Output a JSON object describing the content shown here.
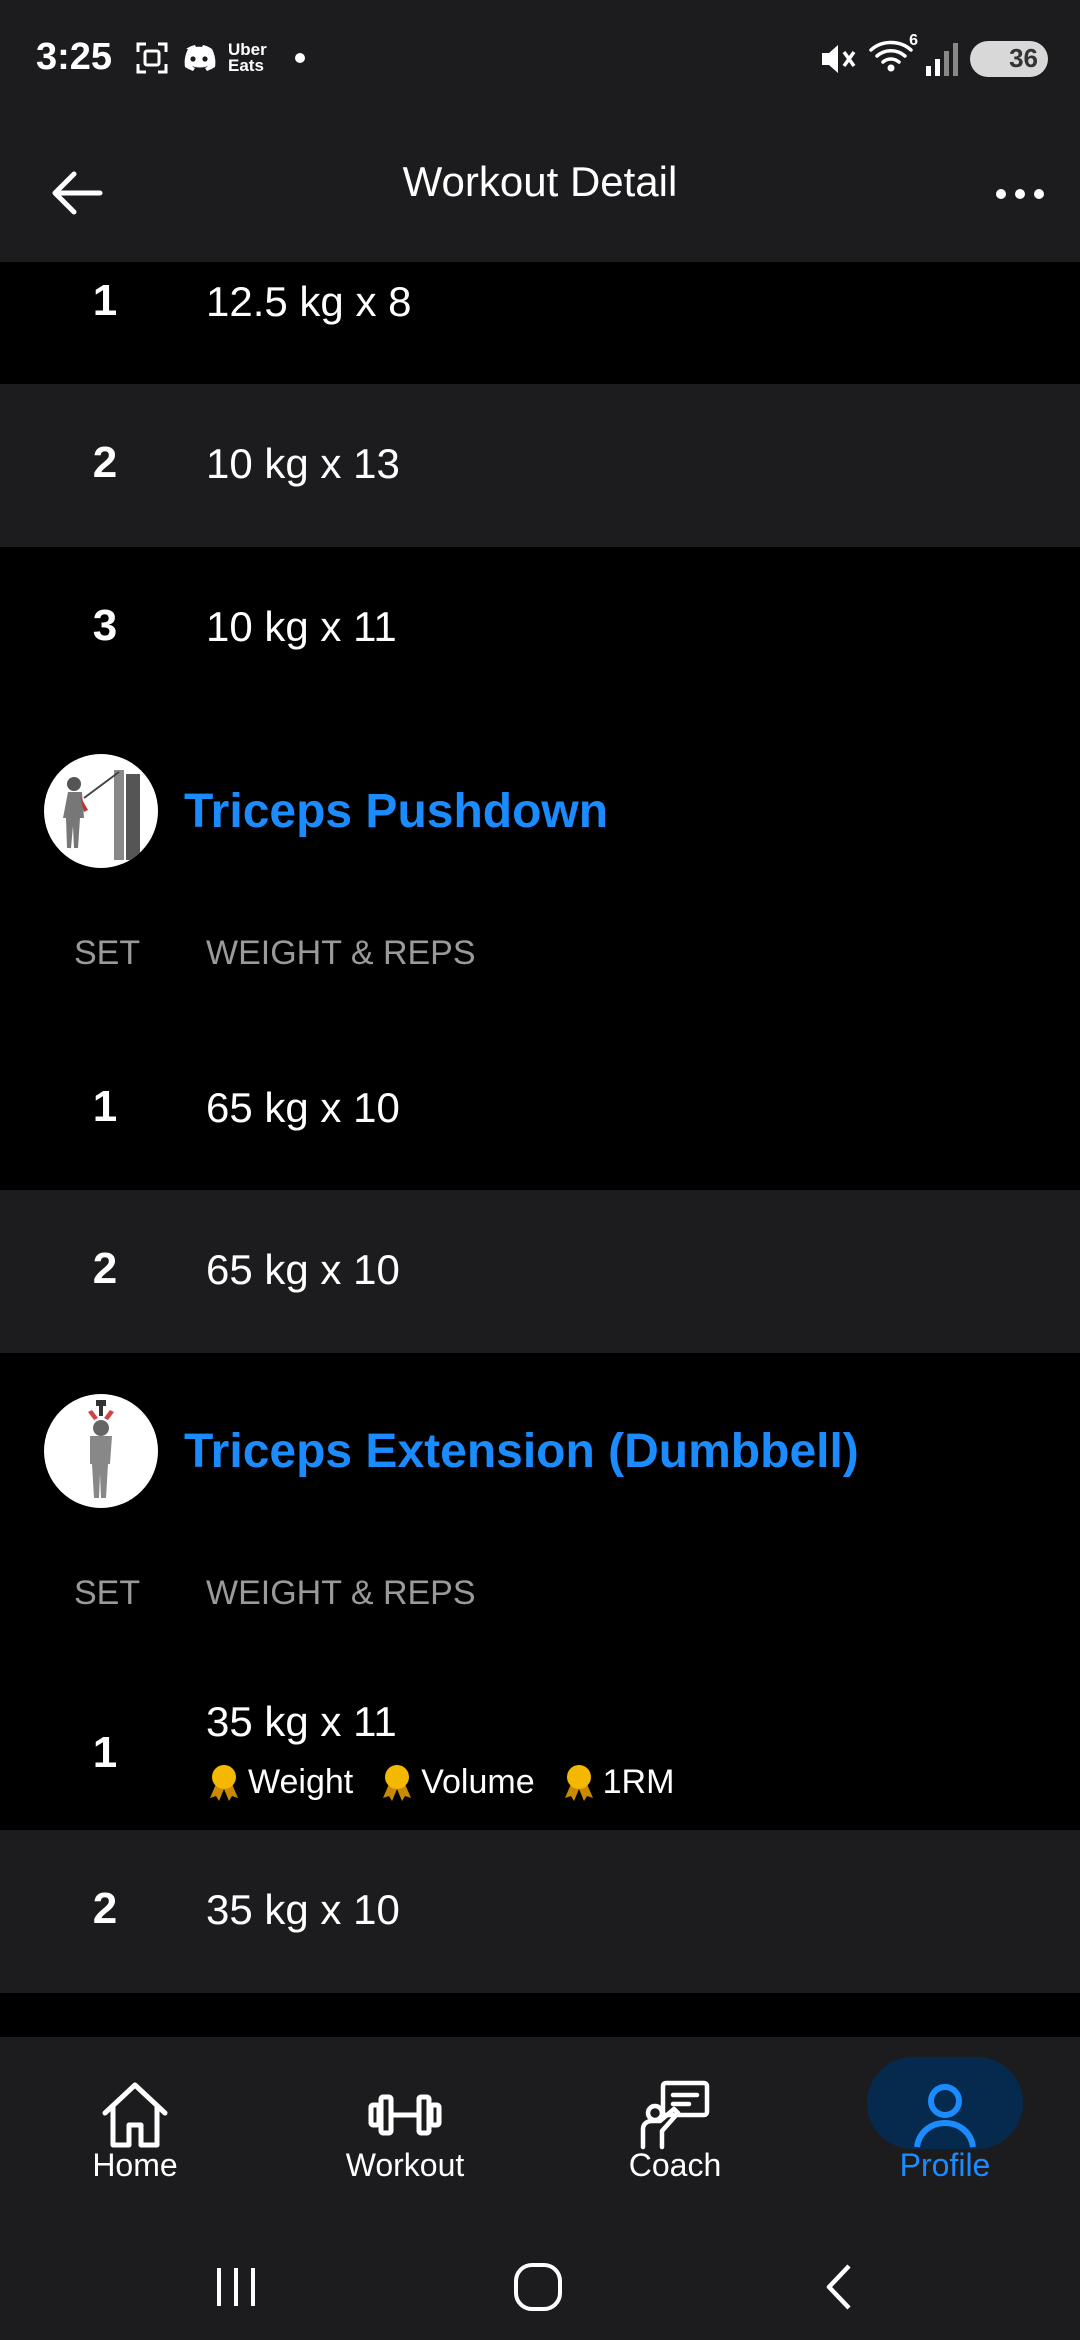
{
  "status_bar": {
    "time": "3:25",
    "uber_line1": "Uber",
    "uber_line2": "Eats",
    "network_badge": "6",
    "battery_level": "36"
  },
  "header": {
    "title": "Workout Detail"
  },
  "previous_exercise_sets": [
    {
      "set": "1",
      "value": "12.5 kg x 8"
    },
    {
      "set": "2",
      "value": "10 kg x 13"
    },
    {
      "set": "3",
      "value": "10 kg x 11"
    }
  ],
  "exercises": [
    {
      "name": "Triceps Pushdown",
      "col_set": "SET",
      "col_weight": "WEIGHT & REPS",
      "sets": [
        {
          "set": "1",
          "value": "65 kg x 10"
        },
        {
          "set": "2",
          "value": "65 kg x 10"
        }
      ]
    },
    {
      "name": "Triceps Extension (Dumbbell)",
      "col_set": "SET",
      "col_weight": "WEIGHT & REPS",
      "sets": [
        {
          "set": "1",
          "value": "35 kg x 11",
          "badges": [
            "Weight",
            "Volume",
            "1RM"
          ]
        },
        {
          "set": "2",
          "value": "35 kg x 10"
        }
      ]
    }
  ],
  "bottom_nav": {
    "items": [
      {
        "label": "Home",
        "icon": "home-icon"
      },
      {
        "label": "Workout",
        "icon": "dumbbell-icon"
      },
      {
        "label": "Coach",
        "icon": "coach-icon"
      },
      {
        "label": "Profile",
        "icon": "profile-icon",
        "active": true
      }
    ]
  },
  "colors": {
    "accent": "#1a8cff",
    "row_alt": "#1c1c1e",
    "background": "#000000",
    "medal": "#f5b800"
  }
}
